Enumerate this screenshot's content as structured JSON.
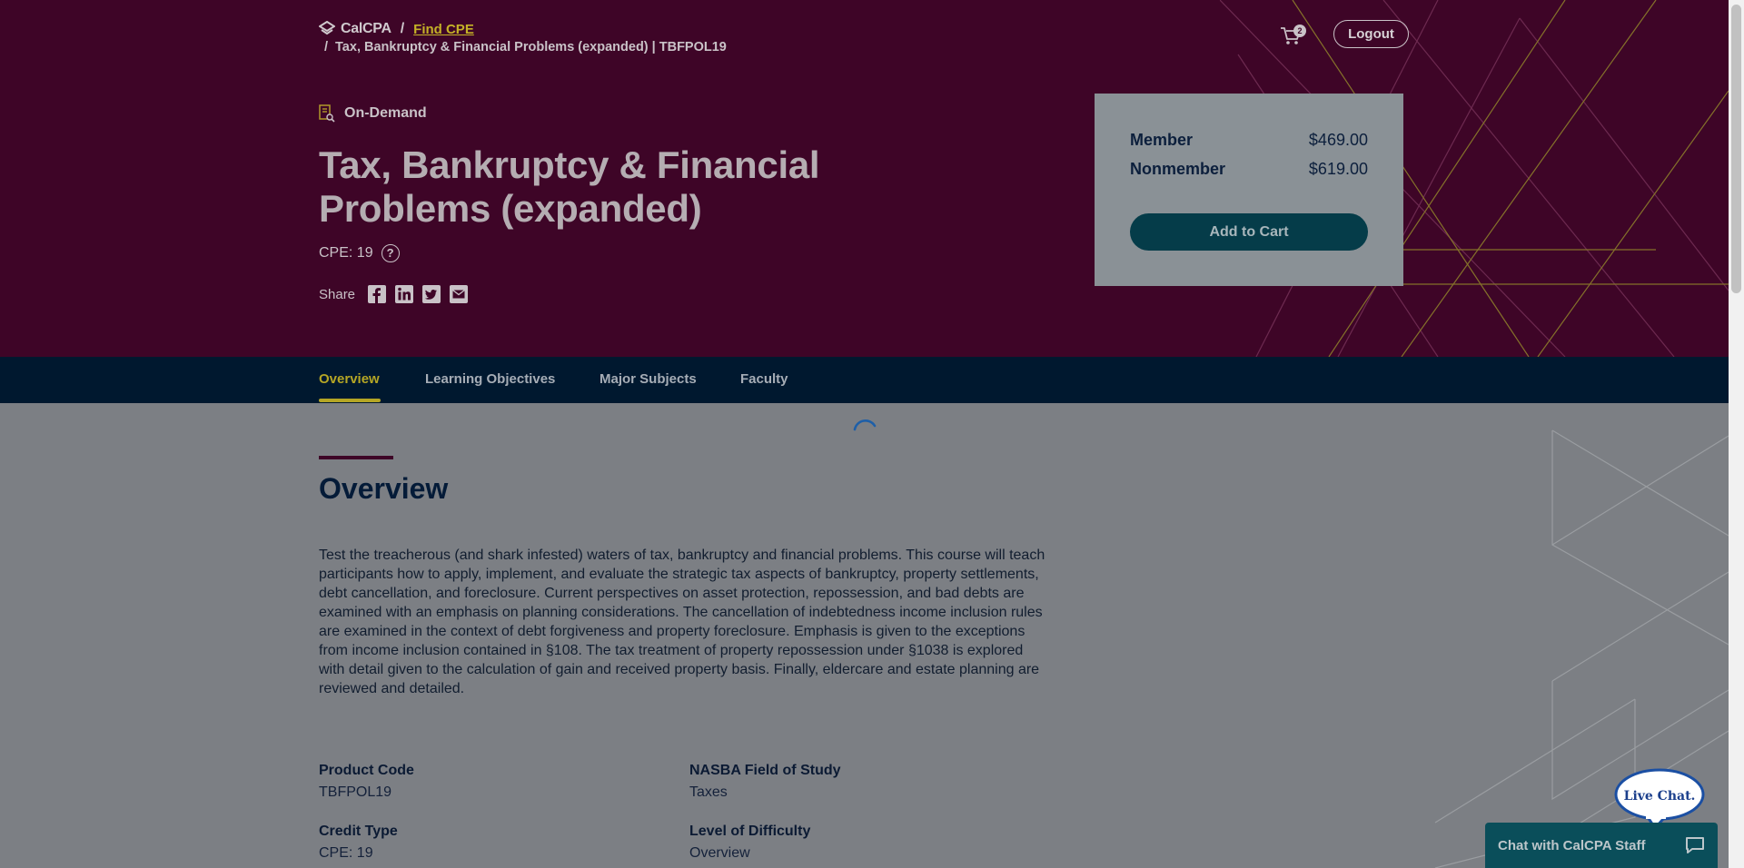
{
  "breadcrumb": {
    "logo_text": "CalCPA",
    "separator": "/",
    "link": "Find CPE",
    "current": "Tax, Bankruptcy & Financial Problems (expanded) | TBFPOL19"
  },
  "header": {
    "cart_count": "2",
    "logout_label": "Logout"
  },
  "course": {
    "format": "On-Demand",
    "title": "Tax, Bankruptcy & Financial Problems (expanded)",
    "cpe": "CPE: 19",
    "help_glyph": "?",
    "share_label": "Share"
  },
  "pricing": {
    "member_label": "Member",
    "member_price": "$469.00",
    "nonmember_label": "Nonmember",
    "nonmember_price": "$619.00",
    "add_to_cart": "Add to Cart"
  },
  "tabs": [
    {
      "label": "Overview",
      "active": true
    },
    {
      "label": "Learning Objectives",
      "active": false
    },
    {
      "label": "Major Subjects",
      "active": false
    },
    {
      "label": "Faculty",
      "active": false
    }
  ],
  "overview": {
    "heading": "Overview",
    "description": "Test the treacherous (and shark infested) waters of tax, bankruptcy and financial problems. This course will teach participants how to apply, implement, and evaluate the strategic tax aspects of bankruptcy, property settlements, debt cancellation, and foreclosure. Current perspectives on asset protection, repossession, and bad debts are examined with an emphasis on planning considerations. The cancellation of indebtedness income inclusion rules are examined in the context of debt forgiveness and property foreclosure. Emphasis is given to the exceptions from income inclusion contained in §108. The tax treatment of property repossession under §1038 is explored with detail given to the calculation of gain and received property basis. Finally, eldercare and estate planning are reviewed and detailed.",
    "details": {
      "product_code_label": "Product Code",
      "product_code": "TBFPOL19",
      "field_label": "NASBA Field of Study",
      "field": "Taxes",
      "credit_type_label": "Credit Type",
      "credit_type": "CPE: 19",
      "difficulty_label": "Level of Difficulty",
      "difficulty": "Overview"
    }
  },
  "chat": {
    "bubble": "Live Chat.",
    "bar_label": "Chat with CalCPA Staff"
  },
  "colors": {
    "hero_bg": "#3e0527",
    "nav_bg": "#00182f",
    "accent": "#b5a625",
    "cart_button": "#053c49"
  },
  "icons": [
    "calcpa-logo-icon",
    "cart-icon",
    "on-demand-icon",
    "help-icon",
    "facebook-icon",
    "linkedin-icon",
    "twitter-icon",
    "email-icon",
    "chat-icon"
  ]
}
